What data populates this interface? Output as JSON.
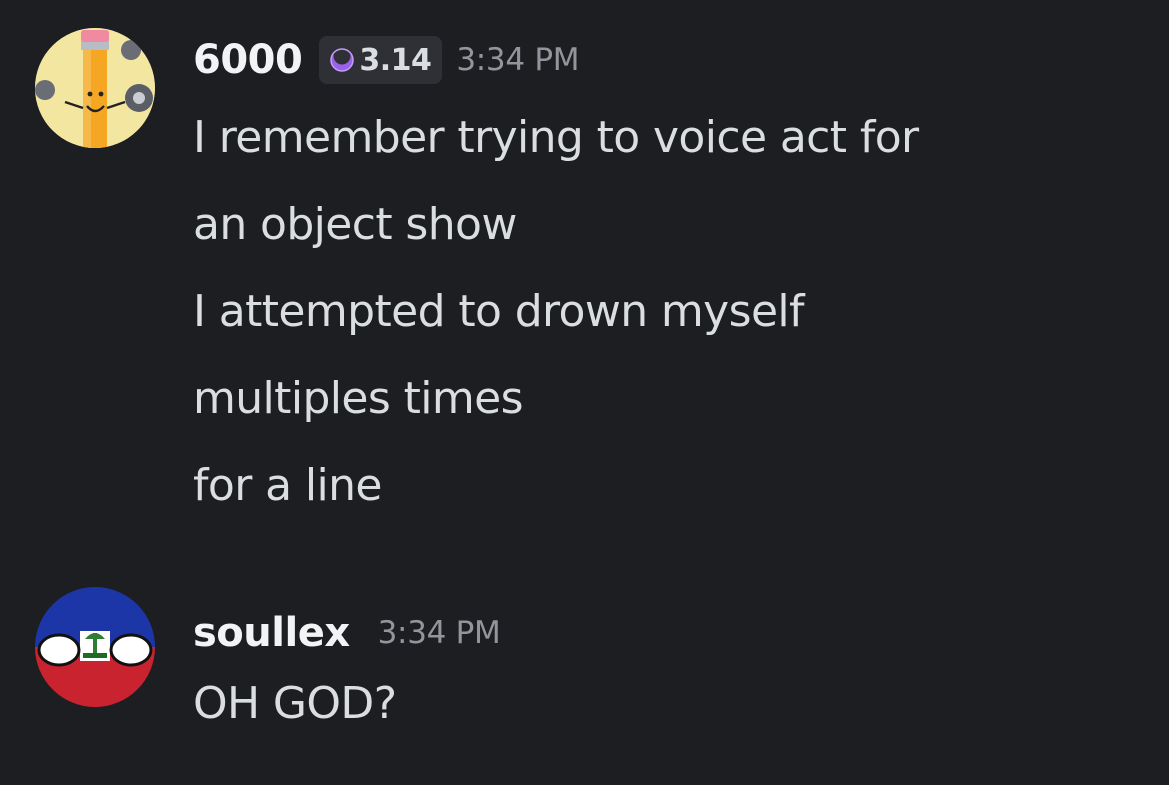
{
  "messages": [
    {
      "author": "6000",
      "avatar": "pencil-character-avatar",
      "badge": {
        "icon": "crescent-moon-icon",
        "label": "3.14",
        "color": "#b57af5"
      },
      "timestamp": "3:34 PM",
      "lines": [
        "I remember trying to voice act for",
        "an object show",
        "I attempted to drown myself",
        "multiples times",
        "for a line"
      ]
    },
    {
      "author": "soullex",
      "avatar": "haiti-countryball-avatar",
      "timestamp": "3:34 PM",
      "lines": [
        "OH GOD?"
      ]
    }
  ],
  "colors": {
    "background": "#1d1e22",
    "username": "#f2f3f5",
    "message_text": "#dbdee1",
    "timestamp": "#94959c",
    "badge_bg": "#2f3036"
  }
}
